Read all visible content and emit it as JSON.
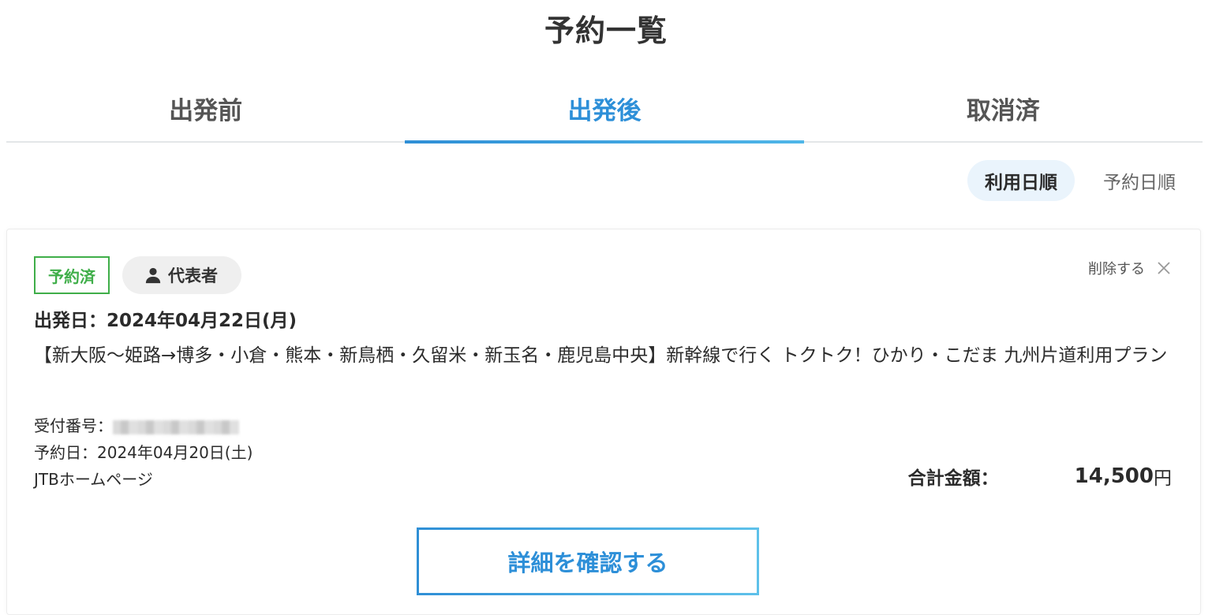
{
  "page": {
    "title": "予約一覧"
  },
  "tabs": [
    {
      "label": "出発前",
      "active": false
    },
    {
      "label": "出発後",
      "active": true
    },
    {
      "label": "取消済",
      "active": false
    }
  ],
  "sort": {
    "options": [
      {
        "label": "利用日順",
        "active": true
      },
      {
        "label": "予約日順",
        "active": false
      }
    ]
  },
  "reservation": {
    "status_badge": "予約済",
    "role_badge": "代表者",
    "delete_label": "削除する",
    "departure": "出発日：2024年04月22日(月)",
    "plan_title": "【新大阪〜姫路→博多・小倉・熊本・新鳥栖・久留米・新玉名・鹿児島中央】新幹線で行く トクトク！ひかり・こだま 九州片道利用プラン",
    "receipt_label": "受付番号：",
    "reservation_date": "予約日：2024年04月20日(土)",
    "channel": "JTBホームページ",
    "total_label": "合計金額：",
    "total_amount": "14,500",
    "total_unit": "円",
    "detail_button": "詳細を確認する"
  },
  "colors": {
    "accent": "#2d8fd8",
    "status_green": "#3fae49",
    "sort_active_bg": "#eaf4fc"
  },
  "icons": {
    "person": "person-icon",
    "close": "close-icon"
  }
}
